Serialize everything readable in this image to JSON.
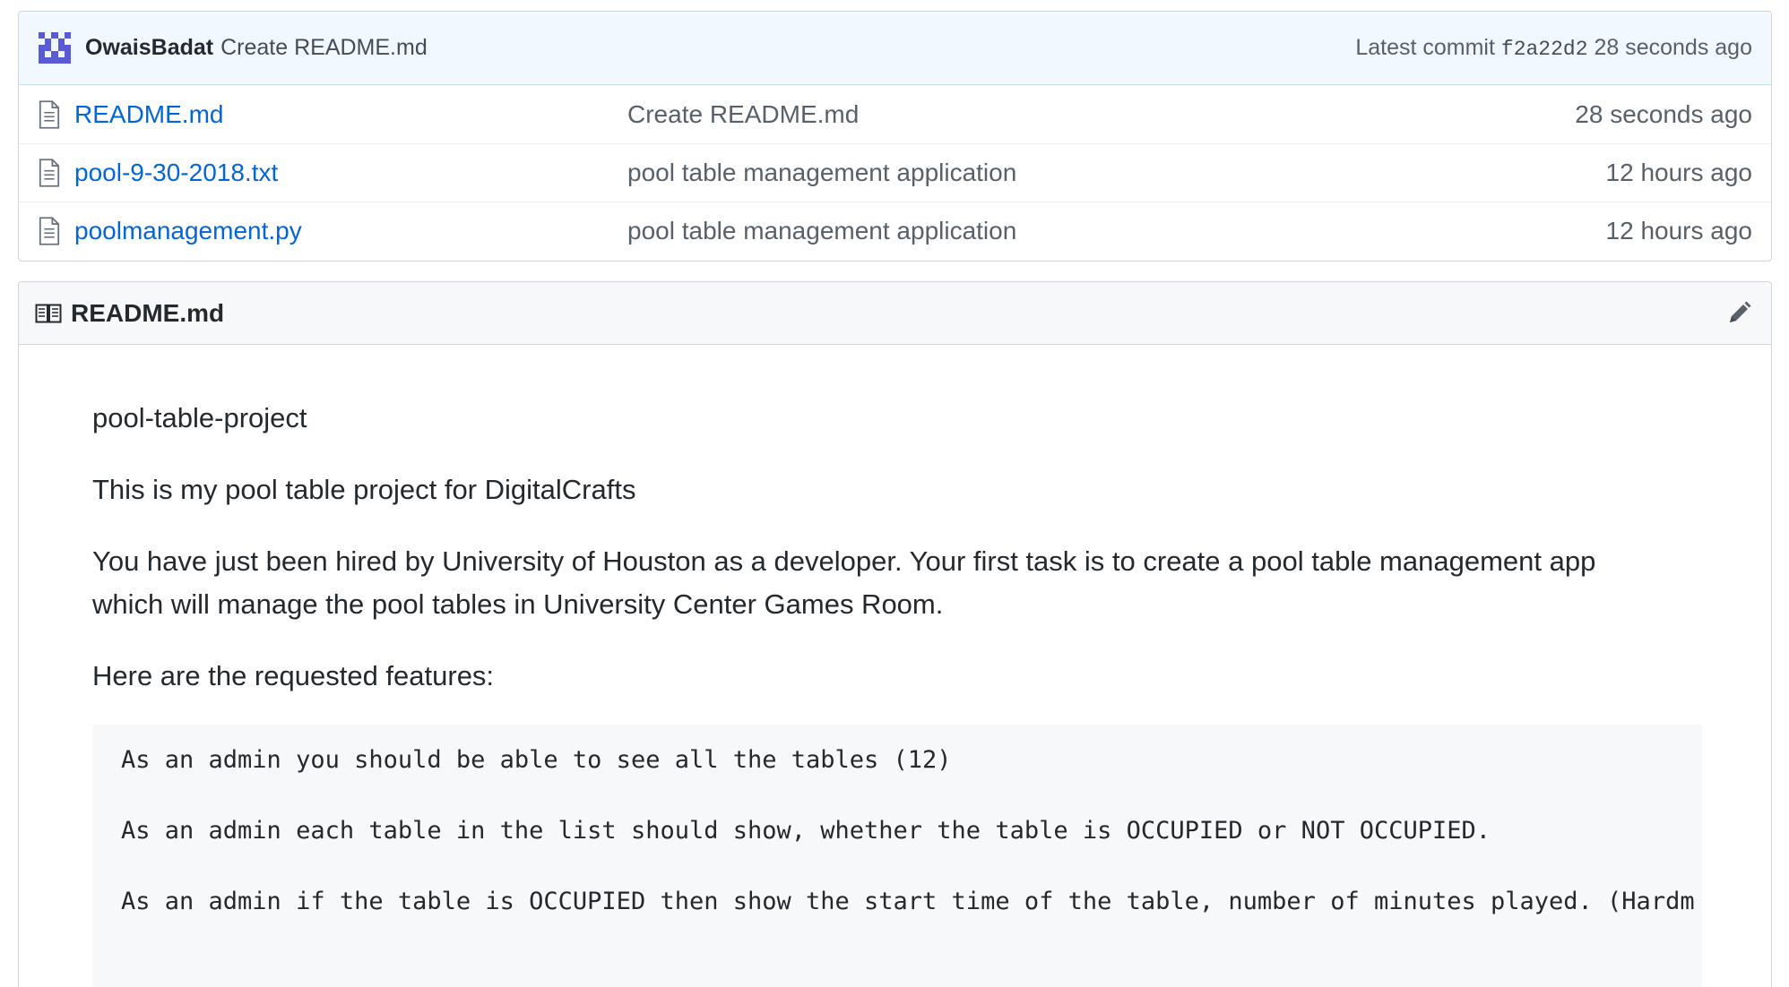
{
  "commit": {
    "author": "OwaisBadat",
    "message": "Create README.md",
    "latest_label": "Latest commit",
    "sha": "f2a22d2",
    "age": "28 seconds ago",
    "avatar_color": "#5a5bd2"
  },
  "files": [
    {
      "icon": "file-icon",
      "name": "README.md",
      "message": "Create README.md",
      "age": "28 seconds ago"
    },
    {
      "icon": "file-icon",
      "name": "pool-9-30-2018.txt",
      "message": "pool table management application",
      "age": "12 hours ago"
    },
    {
      "icon": "file-icon",
      "name": "poolmanagement.py",
      "message": "pool table management application",
      "age": "12 hours ago"
    }
  ],
  "readme": {
    "icon": "book-icon",
    "title": "README.md",
    "edit_icon": "pencil-icon",
    "heading": "pool-table-project",
    "intro": "This is my pool table project for DigitalCrafts",
    "para_line1": "You have just been hired by University of Houston as a developer. Your first task is to create a pool table management app",
    "para_line2": "which will manage the pool tables in University Center Games Room.",
    "features_intro": "Here are the requested features:",
    "code_lines": [
      "As an admin you should be able to see all the tables (12)",
      "As an admin each table in the list should show, whether the table is OCCUPIED or NOT OCCUPIED.",
      "As an admin if the table is OCCUPIED then show the start time of the table, number of minutes played. (Hardm"
    ]
  },
  "colors": {
    "link": "#0366d6",
    "commit_bar_bg": "#f1f8ff",
    "muted_text": "#586069"
  }
}
